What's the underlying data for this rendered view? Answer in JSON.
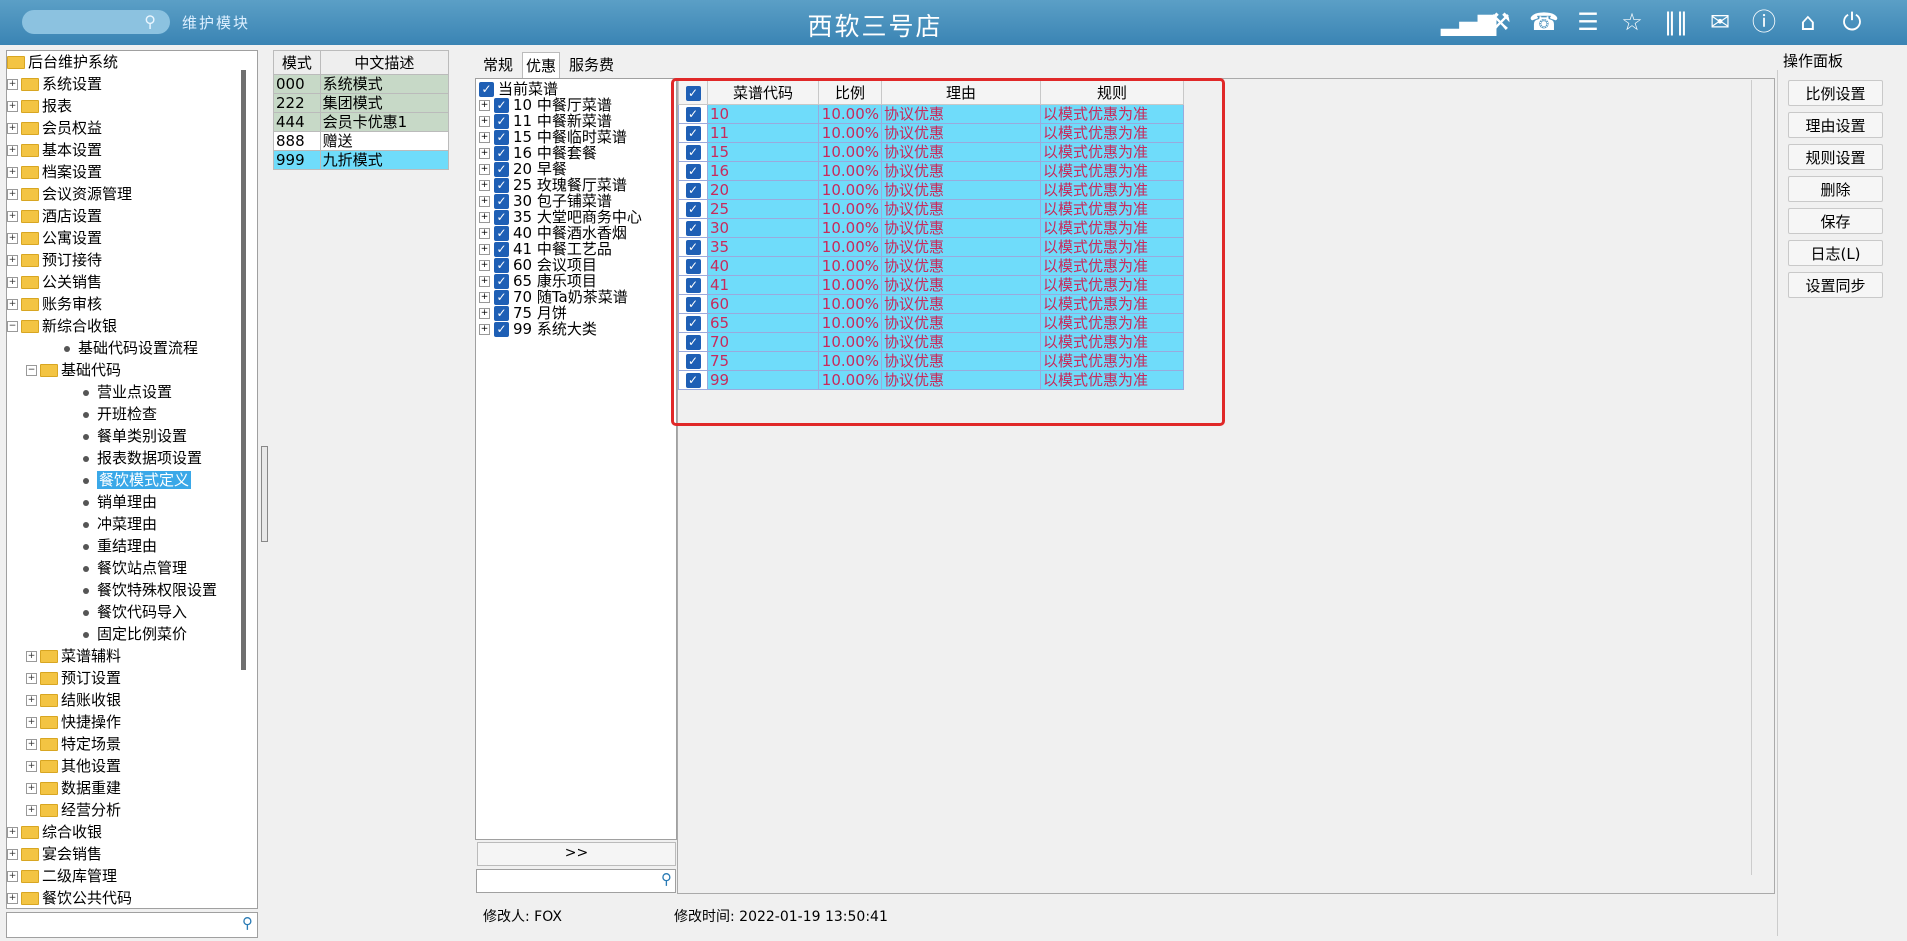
{
  "header": {
    "module_label": "维护模块",
    "store_title": "西软三号店",
    "icons": [
      "signal-icon",
      "tools-icon",
      "phone-icon",
      "menu-icon",
      "star-icon",
      "columns-icon",
      "mail-icon",
      "help-icon",
      "home-icon",
      "power-icon"
    ]
  },
  "tree": {
    "items": [
      {
        "label": "后台维护系统",
        "level": 0,
        "type": "root"
      },
      {
        "label": "系统设置",
        "level": 1,
        "type": "folder"
      },
      {
        "label": "报表",
        "level": 1,
        "type": "folder"
      },
      {
        "label": "会员权益",
        "level": 1,
        "type": "folder"
      },
      {
        "label": "基本设置",
        "level": 1,
        "type": "folder"
      },
      {
        "label": "档案设置",
        "level": 1,
        "type": "folder"
      },
      {
        "label": "会议资源管理",
        "level": 1,
        "type": "folder"
      },
      {
        "label": "酒店设置",
        "level": 1,
        "type": "folder"
      },
      {
        "label": "公寓设置",
        "level": 1,
        "type": "folder"
      },
      {
        "label": "预订接待",
        "level": 1,
        "type": "folder"
      },
      {
        "label": "公关销售",
        "level": 1,
        "type": "folder"
      },
      {
        "label": "账务审核",
        "level": 1,
        "type": "folder"
      },
      {
        "label": "新综合收银",
        "level": 1,
        "type": "folder-open"
      },
      {
        "label": "基础代码设置流程",
        "level": 2,
        "type": "leaf"
      },
      {
        "label": "基础代码",
        "level": 2,
        "type": "folder-open"
      },
      {
        "label": "营业点设置",
        "level": 3,
        "type": "leaf"
      },
      {
        "label": "开班检查",
        "level": 3,
        "type": "leaf"
      },
      {
        "label": "餐单类别设置",
        "level": 3,
        "type": "leaf"
      },
      {
        "label": "报表数据项设置",
        "level": 3,
        "type": "leaf"
      },
      {
        "label": "餐饮模式定义",
        "level": 3,
        "type": "leaf",
        "selected": true
      },
      {
        "label": "销单理由",
        "level": 3,
        "type": "leaf"
      },
      {
        "label": "冲菜理由",
        "level": 3,
        "type": "leaf"
      },
      {
        "label": "重结理由",
        "level": 3,
        "type": "leaf"
      },
      {
        "label": "餐饮站点管理",
        "level": 3,
        "type": "leaf"
      },
      {
        "label": "餐饮特殊权限设置",
        "level": 3,
        "type": "leaf"
      },
      {
        "label": "餐饮代码导入",
        "level": 3,
        "type": "leaf"
      },
      {
        "label": "固定比例菜价",
        "level": 3,
        "type": "leaf"
      },
      {
        "label": "菜谱辅料",
        "level": 2,
        "type": "folder"
      },
      {
        "label": "预订设置",
        "level": 2,
        "type": "folder"
      },
      {
        "label": "结账收银",
        "level": 2,
        "type": "folder"
      },
      {
        "label": "快捷操作",
        "level": 2,
        "type": "folder"
      },
      {
        "label": "特定场景",
        "level": 2,
        "type": "folder"
      },
      {
        "label": "其他设置",
        "level": 2,
        "type": "folder"
      },
      {
        "label": "数据重建",
        "level": 2,
        "type": "folder"
      },
      {
        "label": "经营分析",
        "level": 2,
        "type": "folder"
      },
      {
        "label": "综合收银",
        "level": 1,
        "type": "folder"
      },
      {
        "label": "宴会销售",
        "level": 1,
        "type": "folder"
      },
      {
        "label": "二级库管理",
        "level": 1,
        "type": "folder"
      },
      {
        "label": "餐饮公共代码",
        "level": 1,
        "type": "folder"
      }
    ]
  },
  "modes": {
    "headers": [
      "模式",
      "中文描述"
    ],
    "rows": [
      {
        "code": "000",
        "desc": "系统模式",
        "style": "g"
      },
      {
        "code": "222",
        "desc": "集团模式",
        "style": "g"
      },
      {
        "code": "444",
        "desc": "会员卡优惠1",
        "style": "g"
      },
      {
        "code": "888",
        "desc": "赠送",
        "style": "w"
      },
      {
        "code": "999",
        "desc": "九折模式",
        "style": "c"
      }
    ]
  },
  "tabs": [
    "常规",
    "优惠",
    "服务费"
  ],
  "categories": {
    "root": "当前菜谱",
    "items": [
      {
        "code": "10",
        "name": "中餐厅菜谱"
      },
      {
        "code": "11",
        "name": "中餐新菜谱"
      },
      {
        "code": "15",
        "name": "中餐临时菜谱"
      },
      {
        "code": "16",
        "name": "中餐套餐"
      },
      {
        "code": "20",
        "name": "早餐"
      },
      {
        "code": "25",
        "name": "玫瑰餐厅菜谱"
      },
      {
        "code": "30",
        "name": "包子铺菜谱"
      },
      {
        "code": "35",
        "name": "大堂吧商务中心"
      },
      {
        "code": "40",
        "name": "中餐酒水香烟"
      },
      {
        "code": "41",
        "name": "中餐工艺品"
      },
      {
        "code": "60",
        "name": "会议项目"
      },
      {
        "code": "65",
        "name": "康乐项目"
      },
      {
        "code": "70",
        "name": "随Ta奶茶菜谱"
      },
      {
        "code": "75",
        "name": "月饼"
      },
      {
        "code": "99",
        "name": "系统大类"
      }
    ],
    "expand_label": ">>"
  },
  "grid": {
    "headers": [
      "菜谱代码",
      "比例",
      "理由",
      "规则"
    ],
    "rows": [
      {
        "code": "10",
        "ratio": "10.00%",
        "reason": "协议优惠",
        "rule": "以模式优惠为准"
      },
      {
        "code": "11",
        "ratio": "10.00%",
        "reason": "协议优惠",
        "rule": "以模式优惠为准"
      },
      {
        "code": "15",
        "ratio": "10.00%",
        "reason": "协议优惠",
        "rule": "以模式优惠为准"
      },
      {
        "code": "16",
        "ratio": "10.00%",
        "reason": "协议优惠",
        "rule": "以模式优惠为准"
      },
      {
        "code": "20",
        "ratio": "10.00%",
        "reason": "协议优惠",
        "rule": "以模式优惠为准"
      },
      {
        "code": "25",
        "ratio": "10.00%",
        "reason": "协议优惠",
        "rule": "以模式优惠为准"
      },
      {
        "code": "30",
        "ratio": "10.00%",
        "reason": "协议优惠",
        "rule": "以模式优惠为准"
      },
      {
        "code": "35",
        "ratio": "10.00%",
        "reason": "协议优惠",
        "rule": "以模式优惠为准"
      },
      {
        "code": "40",
        "ratio": "10.00%",
        "reason": "协议优惠",
        "rule": "以模式优惠为准"
      },
      {
        "code": "41",
        "ratio": "10.00%",
        "reason": "协议优惠",
        "rule": "以模式优惠为准"
      },
      {
        "code": "60",
        "ratio": "10.00%",
        "reason": "协议优惠",
        "rule": "以模式优惠为准"
      },
      {
        "code": "65",
        "ratio": "10.00%",
        "reason": "协议优惠",
        "rule": "以模式优惠为准"
      },
      {
        "code": "70",
        "ratio": "10.00%",
        "reason": "协议优惠",
        "rule": "以模式优惠为准"
      },
      {
        "code": "75",
        "ratio": "10.00%",
        "reason": "协议优惠",
        "rule": "以模式优惠为准"
      },
      {
        "code": "99",
        "ratio": "10.00%",
        "reason": "协议优惠",
        "rule": "以模式优惠为准"
      }
    ]
  },
  "footer": {
    "modifier": "修改人: FOX",
    "modified_time": "修改时间: 2022-01-19 13:50:41"
  },
  "ops": {
    "title": "操作面板",
    "buttons": [
      "比例设置",
      "理由设置",
      "规则设置",
      "删除",
      "保存",
      "日志(L)",
      "设置同步"
    ]
  },
  "colors": {
    "accent": "#3a84b4",
    "row_highlight": "#6fdcfa",
    "grid_text": "#c82a5c",
    "frame": "#e02828"
  }
}
